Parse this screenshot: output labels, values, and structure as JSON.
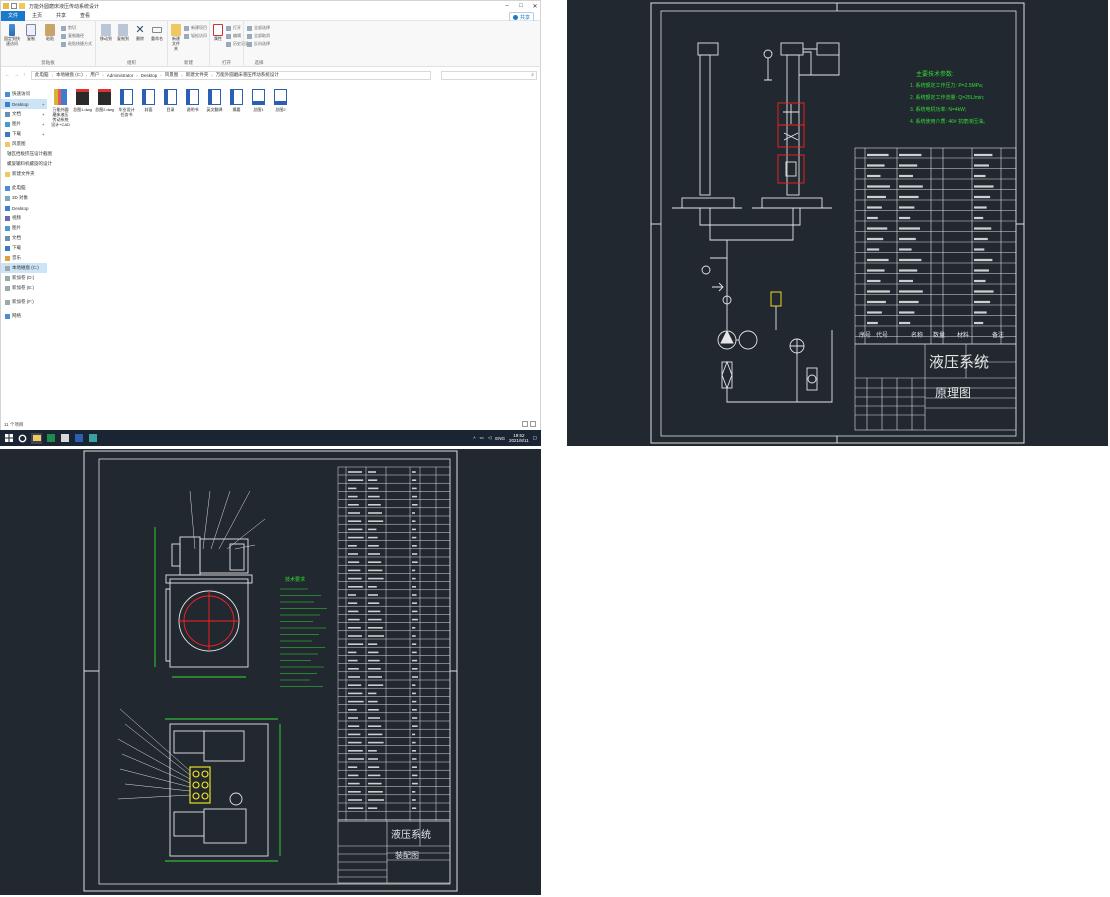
{
  "explorer": {
    "window_title": "万能外圆磨床液压传动系统设计",
    "tabs": [
      "文件",
      "主页",
      "共享",
      "查看"
    ],
    "share_label": "共享",
    "ribbon": {
      "clipboard": {
        "group_label": "剪贴板",
        "pin": "固定到快速访问",
        "copy": "复制",
        "paste": "粘贴",
        "cut": "剪切",
        "copy_path": "复制路径",
        "paste_shortcut": "粘贴快捷方式"
      },
      "organize": {
        "group_label": "组织",
        "move_to": "移动到",
        "copy_to": "复制到",
        "delete": "删除",
        "rename": "重命名"
      },
      "new": {
        "group_label": "新建",
        "new_folder": "新建文件夹",
        "new_item": "新建项目",
        "easy_access": "轻松访问"
      },
      "open": {
        "group_label": "打开",
        "properties": "属性",
        "open": "打开",
        "edit": "编辑",
        "history": "历史记录"
      },
      "select": {
        "group_label": "选择",
        "select_all": "全部选择",
        "select_none": "全部取消",
        "invert": "反向选择"
      }
    },
    "address": {
      "crumbs": [
        "此电脑",
        "本地磁盘 (C:)",
        "用户",
        "Administrator",
        "Desktop",
        "风景图",
        "新建文件夹",
        "万能外圆磨床液压传动系统设计"
      ],
      "search_icon": "search-icon"
    },
    "nav": {
      "quick_access": "快速访问",
      "quick_items": [
        "Desktop",
        "文档",
        "图片",
        "下载",
        "风景图",
        "轴瓦挡板挤压设计截图",
        "螺旋输料机螺旋的设计",
        "新建文件夹"
      ],
      "this_pc": "此电脑",
      "pc_items": [
        "3D 对象",
        "Desktop",
        "视频",
        "图片",
        "文档",
        "下载",
        "音乐",
        "本地磁盘 (C:)",
        "新加卷 (D:)",
        "新加卷 (E:)"
      ],
      "removable": "新加卷 (F:)",
      "network": "网络"
    },
    "files": [
      {
        "name": "万能外圆磨床液压传动系统设计+CAD",
        "type": "zip"
      },
      {
        "name": "总图1.dwg",
        "type": "dwg"
      },
      {
        "name": "总图2.dwg",
        "type": "dwg"
      },
      {
        "name": "毕业设计任务书",
        "type": "doc"
      },
      {
        "name": "封面",
        "type": "doc"
      },
      {
        "name": "目录",
        "type": "doc"
      },
      {
        "name": "说明书",
        "type": "doc"
      },
      {
        "name": "英文翻译",
        "type": "doc"
      },
      {
        "name": "摘要",
        "type": "doc"
      },
      {
        "name": "总图1",
        "type": "img"
      },
      {
        "name": "总图2",
        "type": "img"
      }
    ],
    "status": "11 个项目"
  },
  "taskbar": {
    "lang": "ENG",
    "time": "19:52",
    "date": "2021/8/11"
  },
  "cad_top": {
    "title_block": {
      "name": "液压系统",
      "subtitle": "原理图"
    },
    "notes_heading": "主要技术参数:",
    "notes": [
      "1. 系统额定工作压力: P=2.5MPa;",
      "2. 系统额定工作流量: Q=25L/min;",
      "3. 系统电机功率: N=4kW;",
      "4. 系统使用介质: 46# 抗磨液压油。"
    ],
    "bom_headers": [
      "序号",
      "代号",
      "名称",
      "数量",
      "材料",
      "备注"
    ]
  },
  "cad_bottom": {
    "title_block": {
      "name": "液压系统",
      "subtitle": "装配图"
    },
    "notes_heading": "技术要求"
  },
  "colors": {
    "cad_bg": "#212830",
    "taskbar_bg": "#1b2433",
    "accent": "#1979ca",
    "cad_red": "#ff2020",
    "cad_green": "#33dd33",
    "cad_yellow": "#ffee22"
  }
}
